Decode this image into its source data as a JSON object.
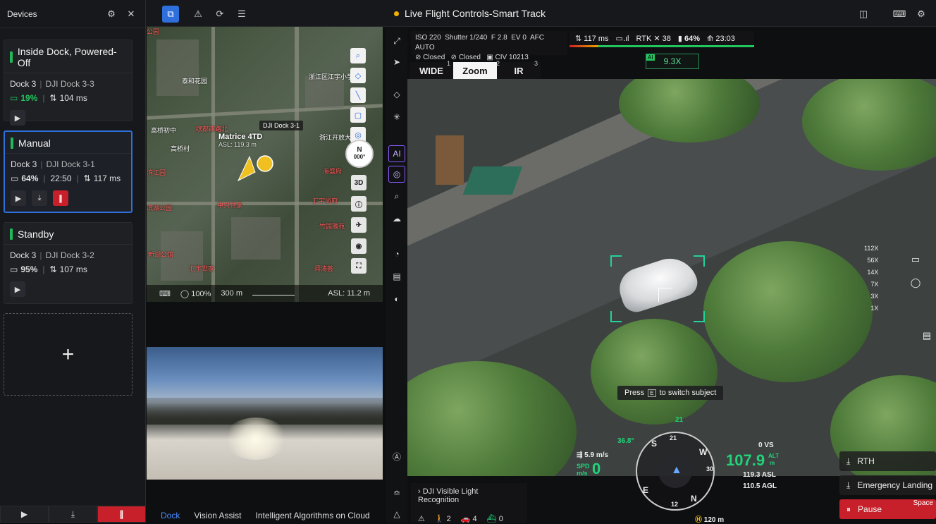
{
  "left_panel": {
    "title": "Devices",
    "docks": [
      {
        "status": "Inside Dock, Powered-Off",
        "dock": "Dock 3",
        "name": "DJI Dock 3-3",
        "battery": "19%",
        "time": "",
        "latency": "104 ms"
      },
      {
        "status": "Manual",
        "dock": "Dock 3",
        "name": "DJI Dock 3-1",
        "battery": "64%",
        "time": "22:50",
        "latency": "117 ms"
      },
      {
        "status": "Standby",
        "dock": "Dock 3",
        "name": "DJI Dock 3-2",
        "battery": "95%",
        "time": "",
        "latency": "107 ms"
      }
    ],
    "add_label": "+"
  },
  "top_bar": {
    "title": "Live Flight Controls-Smart Track"
  },
  "map": {
    "labels": [
      "公园",
      "泰和花园",
      "浙江区江宇小学",
      "高桥初中",
      "缤都西路北",
      "高桥村",
      "浙江开放大学",
      "滨江园",
      "海盛府",
      "滨湖公园",
      "汇宇尚府",
      "中兴世家",
      "竹园雅苑",
      "新湖公馆",
      "闻涛荟",
      "汇宇世家"
    ],
    "drone_name": "Matrice 4TD",
    "drone_asl": "ASL: 119.3 m",
    "dock_label": "DJI Dock 3-1",
    "compass_n": "N",
    "compass_deg": "000°",
    "btn_3d": "3D",
    "zoom_pct": "100%",
    "scale": "300 m",
    "asl": "ASL: 11.2 m"
  },
  "dock_tabs": [
    "Dock",
    "Vision Assist",
    "Intelligent Algorithms on Cloud"
  ],
  "camera": {
    "iso": "ISO 220",
    "shutter": "Shutter 1/240",
    "fstop": "F 2.8",
    "ev": "EV 0",
    "afc": "AFC",
    "auto": "AUTO",
    "closed1": "Closed",
    "closed2": "Closed",
    "civ": "CIV 10213",
    "latency": "117 ms",
    "rtk": "RTK",
    "sats": "38",
    "battery": "64%",
    "time": "23:03",
    "lenses": [
      {
        "label": "WIDE",
        "num": "1"
      },
      {
        "label": "Zoom",
        "num": "2"
      },
      {
        "label": "IR",
        "num": "3"
      }
    ],
    "ai_zoom": "9.3X",
    "ai_tag": "AI",
    "zoom_scale": [
      "112X",
      "56X",
      "14X",
      "7X",
      "3X",
      "1X"
    ],
    "tooltip_pre": "Press",
    "tooltip_key": "E",
    "tooltip_post": "to switch subject"
  },
  "hud": {
    "gimbal_angle": "36.8°",
    "heading_num": "21",
    "wind": "5.9 m/s",
    "spd_label": "SPD",
    "spd_unit": "m/s",
    "spd": "0",
    "vs": "0 VS",
    "alt": "107.9",
    "alt_label": "ALT",
    "alt_unit": "m",
    "asl": "119.3 ASL",
    "agl": "110.5 AGL",
    "dist": "120 m",
    "compass_ticks": [
      "S",
      "21",
      "W",
      "30",
      "N",
      "E",
      "12"
    ]
  },
  "detection": {
    "title": "DJI Visible Light Recognition",
    "persons": "2",
    "cars": "4",
    "boats": "0"
  },
  "actions": {
    "rth": "RTH",
    "landing": "Emergency Landing",
    "pause": "Pause",
    "space": "Space"
  }
}
